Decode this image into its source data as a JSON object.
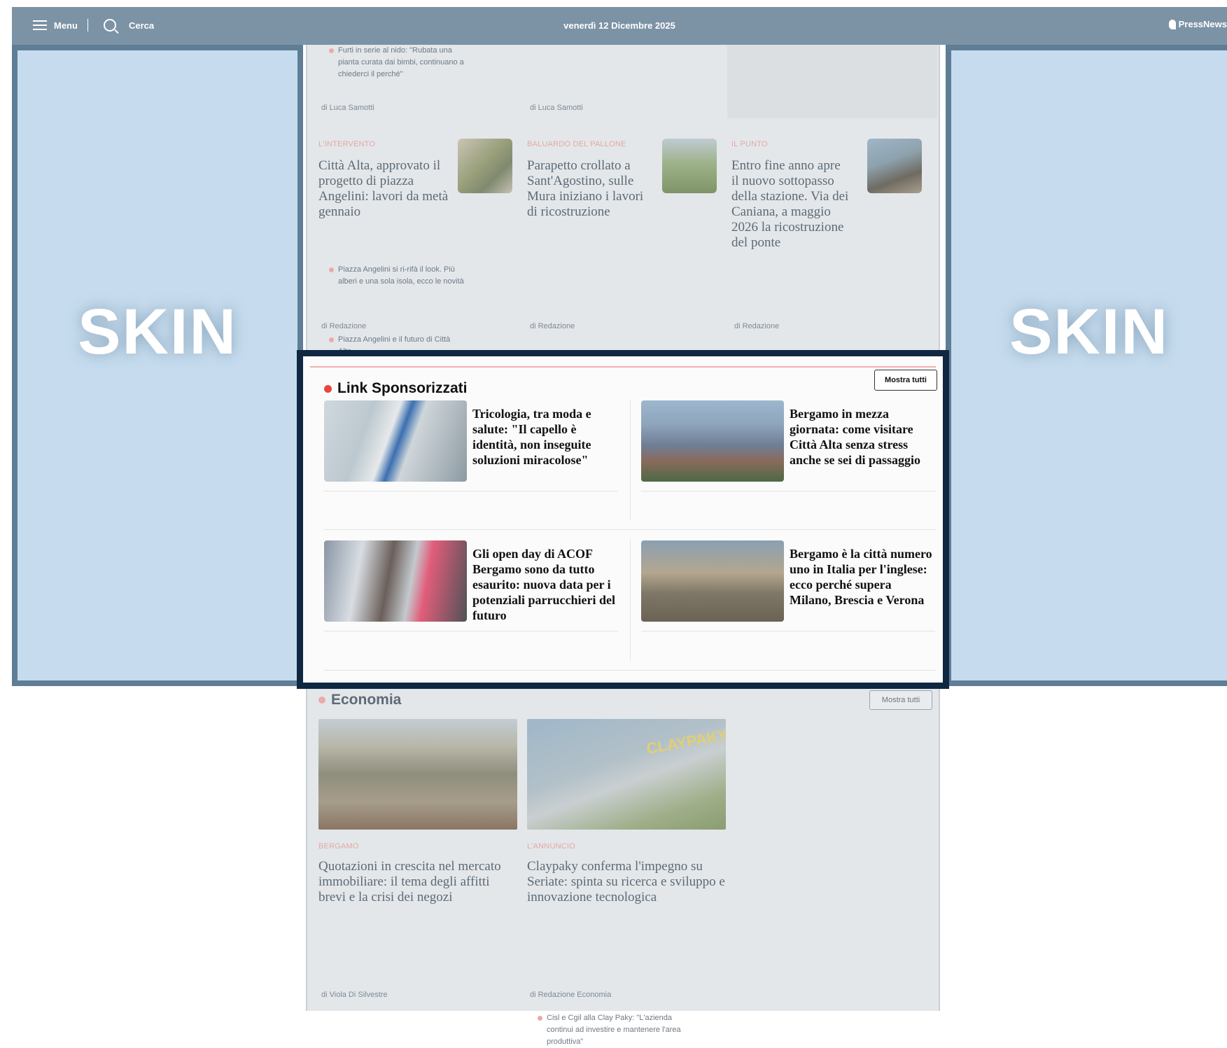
{
  "topbar": {
    "menu_label": "Menu",
    "search_label": "Cerca",
    "date": "venerdì 12 Dicembre 2025",
    "brand": "PressNews"
  },
  "skin": {
    "left_label": "SKIN",
    "right_label": "SKIN"
  },
  "top_row": {
    "related": "Furti in serie al nido: \"Rubata una pianta curata dai bimbi, continuano a chiederci il perché\"",
    "author1": "di Luca Samotti",
    "author2": "di Luca Samotti"
  },
  "articles_row": [
    {
      "kicker": "L'INTERVENTO",
      "title": "Città Alta, approvato il progetto di piazza Angelini: lavori da metà gennaio",
      "related": [
        "Piazza Angelini si ri-rifà il look. Più alberi e una sola isola, ecco le novità",
        "Piazza Angelini e il futuro di Città Alta"
      ],
      "author": "di Redazione"
    },
    {
      "kicker": "BALUARDO DEL PALLONE",
      "title": "Parapetto crollato a Sant'Agostino, sulle Mura iniziano i lavori di ricostruzione",
      "author": "di Redazione"
    },
    {
      "kicker": "IL PUNTO",
      "title": "Entro fine anno apre il nuovo sottopasso della stazione. Via dei Caniana, a maggio 2026 la ricostruzione del ponte",
      "author": "di Redazione"
    }
  ],
  "sponsored": {
    "heading": "Link Sponsorizzati",
    "button": "Mostra tutti",
    "cards": [
      {
        "title": "Tricologia, tra moda e salute: \"Il capello è identità, non inseguite soluzioni miracolose\""
      },
      {
        "title": "Bergamo in mezza giornata: come visitare Città Alta senza stress anche se sei di passaggio"
      },
      {
        "title": "Gli open day di ACOF Bergamo sono da tutto esaurito: nuova data per i potenziali parrucchieri del futuro"
      },
      {
        "title": "Bergamo è la città numero uno in Italia per l'inglese: ecco perché supera Milano, Brescia e Verona"
      }
    ]
  },
  "economia": {
    "heading": "Economia",
    "button": "Mostra tutti",
    "articles": [
      {
        "kicker": "BERGAMO",
        "title": "Quotazioni in crescita nel mercato immobiliare: il tema degli affitti brevi e la crisi dei negozi",
        "author": "di Viola Di Silvestre"
      },
      {
        "kicker": "L'ANNUNCIO",
        "title": "Claypaky conferma l'impegno su Seriate: spinta su ricerca e sviluppo e innovazione tecnologica",
        "related": "Cisl e Cgil alla Clay Paky: \"L'azienda continui ad investire e mantenere l'area produttiva\"",
        "author": "di Redazione Economia",
        "sign": "CLAYPAKY"
      }
    ]
  },
  "colors": {
    "accent": "#e8463d",
    "frame": "#0f2741",
    "skin_bg": "#c6dcee",
    "topbar": "#7c93a6"
  }
}
